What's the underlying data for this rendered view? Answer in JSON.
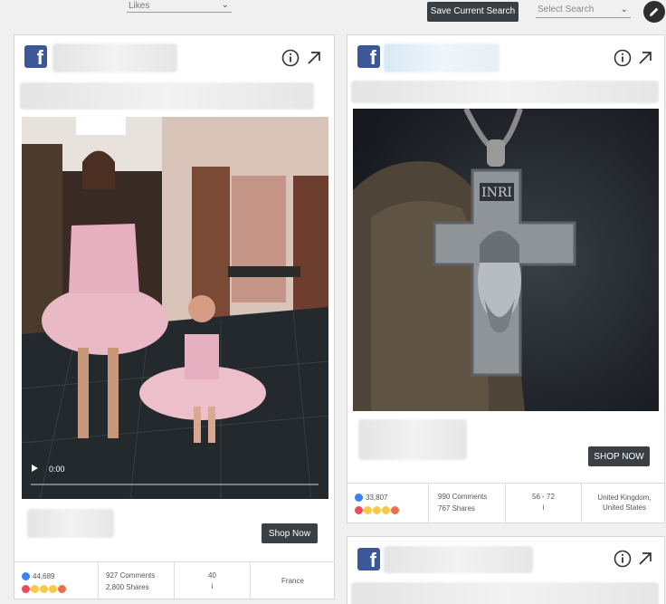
{
  "toolbar": {
    "sort_value": "Likes",
    "save_label": "Save Current Search",
    "search_placeholder": "Select Search"
  },
  "cards": [
    {
      "media_type": "video",
      "video_time": "0:00",
      "cta_label": "Shop Now",
      "stats": {
        "likes": "44,689",
        "comments": "927 Comments",
        "shares": "2,800 Shares",
        "age": "40",
        "age_sub": "i",
        "countries": "France"
      }
    },
    {
      "media_type": "image",
      "cta_label": "SHOP NOW",
      "stats": {
        "likes": "33,807",
        "comments": "990 Comments",
        "shares": "767 Shares",
        "age": "56 - 72",
        "age_sub": "i",
        "countries": "United Kingdom, United States"
      }
    }
  ],
  "icons": {
    "brand": "facebook-icon",
    "info": "info-icon",
    "open": "external-arrow-icon",
    "edit": "pencil-icon"
  },
  "colors": {
    "facebook_blue": "#3b5998",
    "button_dark": "#3a3f44"
  }
}
